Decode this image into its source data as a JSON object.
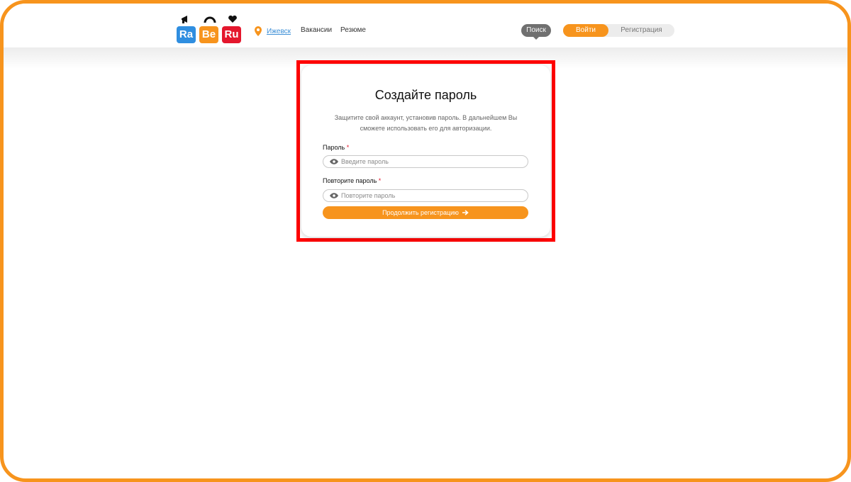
{
  "header": {
    "logo": {
      "tiles": [
        "Ra",
        "Be",
        "Ru"
      ],
      "colors": [
        "#2f8ee0",
        "#f7941d",
        "#e4172d"
      ]
    },
    "city": "Ижевск",
    "nav": {
      "vacancies": "Вакансии",
      "resumes": "Резюме"
    },
    "search_label": "Поиск",
    "login_label": "Войти",
    "register_label": "Регистрация"
  },
  "form": {
    "title": "Создайте пароль",
    "subtitle": "Защитите свой аккаунт, установив пароль. В дальнейшем Вы сможете использовать его для авторизации.",
    "password": {
      "label": "Пароль",
      "required_mark": "*",
      "placeholder": "Введите пароль",
      "icon": "eye-icon"
    },
    "password_repeat": {
      "label": "Повторите пароль",
      "required_mark": "*",
      "placeholder": "Повторите пароль",
      "icon": "eye-icon"
    },
    "submit_label": "Продолжить регистрацию",
    "submit_icon": "arrow-right-icon"
  },
  "colors": {
    "accent": "#f7941d",
    "highlight": "#ff0000",
    "link": "#3d8fd6"
  }
}
